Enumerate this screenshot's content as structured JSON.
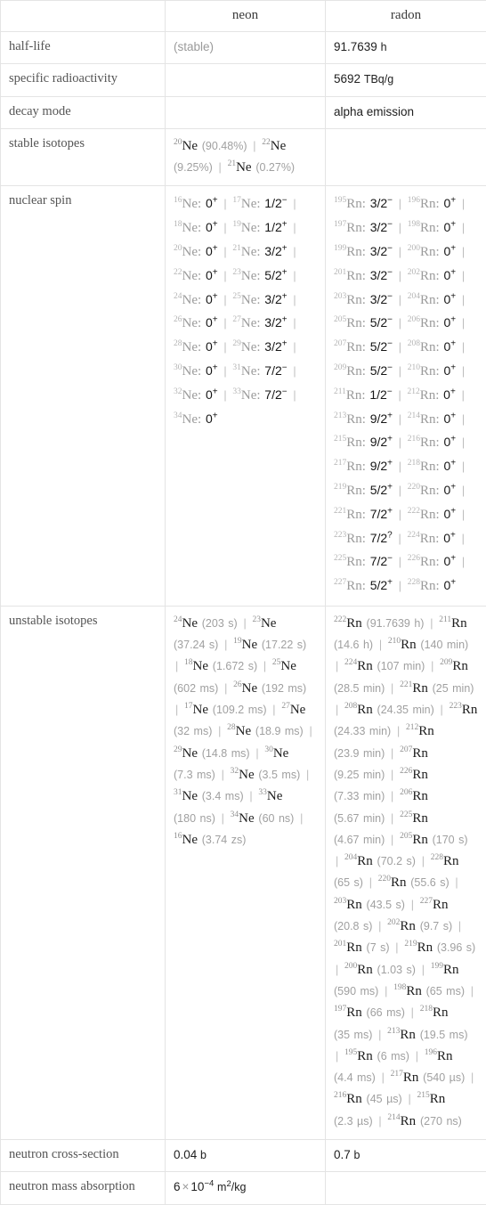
{
  "table": {
    "columns": [
      "",
      "neon",
      "radon"
    ],
    "rows": [
      {
        "label": "half-life",
        "neon": "(stable)",
        "radon_value": "91.7639",
        "radon_unit": "h"
      },
      {
        "label": "specific radioactivity",
        "neon": "",
        "radon_value": "5692",
        "radon_unit": "TBq/g"
      },
      {
        "label": "decay mode",
        "neon": "",
        "radon": "alpha emission"
      },
      {
        "label": "stable isotopes",
        "neon_isotopes": [
          {
            "mass": "20",
            "symbol": "Ne",
            "qty": "(90.48%)"
          },
          {
            "mass": "22",
            "symbol": "Ne",
            "qty": "(9.25%)"
          },
          {
            "mass": "21",
            "symbol": "Ne",
            "qty": "(0.27%)"
          }
        ],
        "radon_isotopes": []
      },
      {
        "label": "nuclear spin",
        "neon_spins": [
          {
            "mass": "16",
            "symbol": "Ne",
            "spin": "0",
            "sign": "+"
          },
          {
            "mass": "17",
            "symbol": "Ne",
            "spin": "1/2",
            "sign": "−"
          },
          {
            "mass": "18",
            "symbol": "Ne",
            "spin": "0",
            "sign": "+"
          },
          {
            "mass": "19",
            "symbol": "Ne",
            "spin": "1/2",
            "sign": "+"
          },
          {
            "mass": "20",
            "symbol": "Ne",
            "spin": "0",
            "sign": "+"
          },
          {
            "mass": "21",
            "symbol": "Ne",
            "spin": "3/2",
            "sign": "+"
          },
          {
            "mass": "22",
            "symbol": "Ne",
            "spin": "0",
            "sign": "+"
          },
          {
            "mass": "23",
            "symbol": "Ne",
            "spin": "5/2",
            "sign": "+"
          },
          {
            "mass": "24",
            "symbol": "Ne",
            "spin": "0",
            "sign": "+"
          },
          {
            "mass": "25",
            "symbol": "Ne",
            "spin": "3/2",
            "sign": "+"
          },
          {
            "mass": "26",
            "symbol": "Ne",
            "spin": "0",
            "sign": "+"
          },
          {
            "mass": "27",
            "symbol": "Ne",
            "spin": "3/2",
            "sign": "+"
          },
          {
            "mass": "28",
            "symbol": "Ne",
            "spin": "0",
            "sign": "+"
          },
          {
            "mass": "29",
            "symbol": "Ne",
            "spin": "3/2",
            "sign": "+"
          },
          {
            "mass": "30",
            "symbol": "Ne",
            "spin": "0",
            "sign": "+"
          },
          {
            "mass": "31",
            "symbol": "Ne",
            "spin": "7/2",
            "sign": "−"
          },
          {
            "mass": "32",
            "symbol": "Ne",
            "spin": "0",
            "sign": "+"
          },
          {
            "mass": "33",
            "symbol": "Ne",
            "spin": "7/2",
            "sign": "−"
          },
          {
            "mass": "34",
            "symbol": "Ne",
            "spin": "0",
            "sign": "+"
          }
        ],
        "radon_spins": [
          {
            "mass": "195",
            "symbol": "Rn",
            "spin": "3/2",
            "sign": "−"
          },
          {
            "mass": "196",
            "symbol": "Rn",
            "spin": "0",
            "sign": "+"
          },
          {
            "mass": "197",
            "symbol": "Rn",
            "spin": "3/2",
            "sign": "−"
          },
          {
            "mass": "198",
            "symbol": "Rn",
            "spin": "0",
            "sign": "+"
          },
          {
            "mass": "199",
            "symbol": "Rn",
            "spin": "3/2",
            "sign": "−"
          },
          {
            "mass": "200",
            "symbol": "Rn",
            "spin": "0",
            "sign": "+"
          },
          {
            "mass": "201",
            "symbol": "Rn",
            "spin": "3/2",
            "sign": "−"
          },
          {
            "mass": "202",
            "symbol": "Rn",
            "spin": "0",
            "sign": "+"
          },
          {
            "mass": "203",
            "symbol": "Rn",
            "spin": "3/2",
            "sign": "−"
          },
          {
            "mass": "204",
            "symbol": "Rn",
            "spin": "0",
            "sign": "+"
          },
          {
            "mass": "205",
            "symbol": "Rn",
            "spin": "5/2",
            "sign": "−"
          },
          {
            "mass": "206",
            "symbol": "Rn",
            "spin": "0",
            "sign": "+"
          },
          {
            "mass": "207",
            "symbol": "Rn",
            "spin": "5/2",
            "sign": "−"
          },
          {
            "mass": "208",
            "symbol": "Rn",
            "spin": "0",
            "sign": "+"
          },
          {
            "mass": "209",
            "symbol": "Rn",
            "spin": "5/2",
            "sign": "−"
          },
          {
            "mass": "210",
            "symbol": "Rn",
            "spin": "0",
            "sign": "+"
          },
          {
            "mass": "211",
            "symbol": "Rn",
            "spin": "1/2",
            "sign": "−"
          },
          {
            "mass": "212",
            "symbol": "Rn",
            "spin": "0",
            "sign": "+"
          },
          {
            "mass": "213",
            "symbol": "Rn",
            "spin": "9/2",
            "sign": "+"
          },
          {
            "mass": "214",
            "symbol": "Rn",
            "spin": "0",
            "sign": "+"
          },
          {
            "mass": "215",
            "symbol": "Rn",
            "spin": "9/2",
            "sign": "+"
          },
          {
            "mass": "216",
            "symbol": "Rn",
            "spin": "0",
            "sign": "+"
          },
          {
            "mass": "217",
            "symbol": "Rn",
            "spin": "9/2",
            "sign": "+"
          },
          {
            "mass": "218",
            "symbol": "Rn",
            "spin": "0",
            "sign": "+"
          },
          {
            "mass": "219",
            "symbol": "Rn",
            "spin": "5/2",
            "sign": "+"
          },
          {
            "mass": "220",
            "symbol": "Rn",
            "spin": "0",
            "sign": "+"
          },
          {
            "mass": "221",
            "symbol": "Rn",
            "spin": "7/2",
            "sign": "+"
          },
          {
            "mass": "222",
            "symbol": "Rn",
            "spin": "0",
            "sign": "+"
          },
          {
            "mass": "223",
            "symbol": "Rn",
            "spin": "7/2",
            "sign": "?"
          },
          {
            "mass": "224",
            "symbol": "Rn",
            "spin": "0",
            "sign": "+"
          },
          {
            "mass": "225",
            "symbol": "Rn",
            "spin": "7/2",
            "sign": "−"
          },
          {
            "mass": "226",
            "symbol": "Rn",
            "spin": "0",
            "sign": "+"
          },
          {
            "mass": "227",
            "symbol": "Rn",
            "spin": "5/2",
            "sign": "+"
          },
          {
            "mass": "228",
            "symbol": "Rn",
            "spin": "0",
            "sign": "+"
          }
        ]
      },
      {
        "label": "unstable isotopes",
        "neon_unstable": [
          {
            "mass": "24",
            "symbol": "Ne",
            "half_life": "(203 s)"
          },
          {
            "mass": "23",
            "symbol": "Ne",
            "half_life": "(37.24 s)"
          },
          {
            "mass": "19",
            "symbol": "Ne",
            "half_life": "(17.22 s)"
          },
          {
            "mass": "18",
            "symbol": "Ne",
            "half_life": "(1.672 s)"
          },
          {
            "mass": "25",
            "symbol": "Ne",
            "half_life": "(602 ms)"
          },
          {
            "mass": "26",
            "symbol": "Ne",
            "half_life": "(192 ms)"
          },
          {
            "mass": "17",
            "symbol": "Ne",
            "half_life": "(109.2 ms)"
          },
          {
            "mass": "27",
            "symbol": "Ne",
            "half_life": "(32 ms)"
          },
          {
            "mass": "28",
            "symbol": "Ne",
            "half_life": "(18.9 ms)"
          },
          {
            "mass": "29",
            "symbol": "Ne",
            "half_life": "(14.8 ms)"
          },
          {
            "mass": "30",
            "symbol": "Ne",
            "half_life": "(7.3 ms)"
          },
          {
            "mass": "32",
            "symbol": "Ne",
            "half_life": "(3.5 ms)"
          },
          {
            "mass": "31",
            "symbol": "Ne",
            "half_life": "(3.4 ms)"
          },
          {
            "mass": "33",
            "symbol": "Ne",
            "half_life": "(180 ns)"
          },
          {
            "mass": "34",
            "symbol": "Ne",
            "half_life": "(60 ns)"
          },
          {
            "mass": "16",
            "symbol": "Ne",
            "half_life": "(3.74 zs)"
          }
        ],
        "radon_unstable": [
          {
            "mass": "222",
            "symbol": "Rn",
            "half_life": "(91.7639 h)"
          },
          {
            "mass": "211",
            "symbol": "Rn",
            "half_life": "(14.6 h)"
          },
          {
            "mass": "210",
            "symbol": "Rn",
            "half_life": "(140 min)"
          },
          {
            "mass": "224",
            "symbol": "Rn",
            "half_life": "(107 min)"
          },
          {
            "mass": "209",
            "symbol": "Rn",
            "half_life": "(28.5 min)"
          },
          {
            "mass": "221",
            "symbol": "Rn",
            "half_life": "(25 min)"
          },
          {
            "mass": "208",
            "symbol": "Rn",
            "half_life": "(24.35 min)"
          },
          {
            "mass": "223",
            "symbol": "Rn",
            "half_life": "(24.33 min)"
          },
          {
            "mass": "212",
            "symbol": "Rn",
            "half_life": "(23.9 min)"
          },
          {
            "mass": "207",
            "symbol": "Rn",
            "half_life": "(9.25 min)"
          },
          {
            "mass": "226",
            "symbol": "Rn",
            "half_life": "(7.33 min)"
          },
          {
            "mass": "206",
            "symbol": "Rn",
            "half_life": "(5.67 min)"
          },
          {
            "mass": "225",
            "symbol": "Rn",
            "half_life": "(4.67 min)"
          },
          {
            "mass": "205",
            "symbol": "Rn",
            "half_life": "(170 s)"
          },
          {
            "mass": "204",
            "symbol": "Rn",
            "half_life": "(70.2 s)"
          },
          {
            "mass": "228",
            "symbol": "Rn",
            "half_life": "(65 s)"
          },
          {
            "mass": "220",
            "symbol": "Rn",
            "half_life": "(55.6 s)"
          },
          {
            "mass": "203",
            "symbol": "Rn",
            "half_life": "(43.5 s)"
          },
          {
            "mass": "227",
            "symbol": "Rn",
            "half_life": "(20.8 s)"
          },
          {
            "mass": "202",
            "symbol": "Rn",
            "half_life": "(9.7 s)"
          },
          {
            "mass": "201",
            "symbol": "Rn",
            "half_life": "(7 s)"
          },
          {
            "mass": "219",
            "symbol": "Rn",
            "half_life": "(3.96 s)"
          },
          {
            "mass": "200",
            "symbol": "Rn",
            "half_life": "(1.03 s)"
          },
          {
            "mass": "199",
            "symbol": "Rn",
            "half_life": "(590 ms)"
          },
          {
            "mass": "198",
            "symbol": "Rn",
            "half_life": "(65 ms)"
          },
          {
            "mass": "197",
            "symbol": "Rn",
            "half_life": "(66 ms)"
          },
          {
            "mass": "218",
            "symbol": "Rn",
            "half_life": "(35 ms)"
          },
          {
            "mass": "213",
            "symbol": "Rn",
            "half_life": "(19.5 ms)"
          },
          {
            "mass": "195",
            "symbol": "Rn",
            "half_life": "(6 ms)"
          },
          {
            "mass": "196",
            "symbol": "Rn",
            "half_life": "(4.4 ms)"
          },
          {
            "mass": "217",
            "symbol": "Rn",
            "half_life": "(540 µs)"
          },
          {
            "mass": "216",
            "symbol": "Rn",
            "half_life": "(45 µs)"
          },
          {
            "mass": "215",
            "symbol": "Rn",
            "half_life": "(2.3 µs)"
          },
          {
            "mass": "214",
            "symbol": "Rn",
            "half_life": "(270 ns)"
          }
        ]
      },
      {
        "label": "neutron cross-section",
        "neon_value": "0.04",
        "neon_unit": "b",
        "radon_value": "0.7",
        "radon_unit": "b"
      },
      {
        "label": "neutron mass absorption",
        "neon_mantissa": "6",
        "neon_times": "×",
        "neon_base": "10",
        "neon_exponent": "−4",
        "neon_unit_a": "m",
        "neon_unit_sup": "2",
        "neon_unit_b": "/kg",
        "radon": ""
      }
    ]
  },
  "colors": {
    "border": "#e4e4e4",
    "label_text": "#555555",
    "value_text": "#202020",
    "dim_text": "#9b9b9b"
  }
}
